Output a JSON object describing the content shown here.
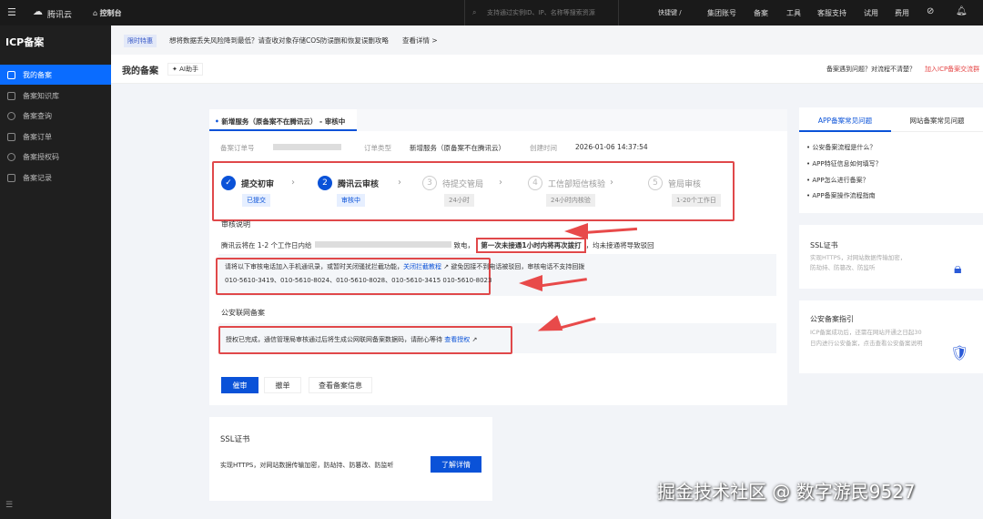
{
  "topbar": {
    "brand": "腾讯云",
    "console": "控制台",
    "search_placeholder": "支持通过实例ID、IP、名称等搜索资源",
    "shortcut": "快捷键 /",
    "nav": [
      "集团账号",
      "备案",
      "工具",
      "客服支持",
      "试用",
      "费用"
    ]
  },
  "sidebar": {
    "title": "ICP备案",
    "items": [
      {
        "label": "我的备案"
      },
      {
        "label": "备案知识库"
      },
      {
        "label": "备案查询"
      },
      {
        "label": "备案订单"
      },
      {
        "label": "备案授权码"
      },
      {
        "label": "备案记录"
      }
    ]
  },
  "notice": {
    "badge": "限时特惠",
    "text": "想将数据丢失风险降到最低？请查收对象存储COS防误删和恢复误删攻略",
    "link": "查看详情 >"
  },
  "header": {
    "title": "我的备案",
    "ai": "AI助手",
    "help": "备案遇到问题？对流程不清楚？",
    "help_link": "加入ICP备案交流群"
  },
  "order": {
    "tab": "新增服务（原备案不在腾讯云） - 审核中",
    "no_label": "备案订单号",
    "type_label": "订单类型",
    "type_value": "新增服务（原备案不在腾讯云）",
    "time_label": "创建时间",
    "time_value": "2026-01-06 14:37:54"
  },
  "steps": [
    {
      "num": "✓",
      "label": "提交初审",
      "tag": "已提交"
    },
    {
      "num": "2",
      "label": "腾讯云审核",
      "tag": "审核中"
    },
    {
      "num": "3",
      "label": "待提交管局",
      "tag": "24小时"
    },
    {
      "num": "4",
      "label": "工信部短信核验",
      "tag": "24小时内核验"
    },
    {
      "num": "5",
      "label": "管局审核",
      "tag": "1-20个工作日"
    }
  ],
  "review": {
    "title": "审核说明",
    "line_a": "腾讯云将在 1-2 个工作日内给",
    "line_b": "致电，",
    "highlight": "第一次未接通1小时内将再次拨打",
    "line_c": "，均未接通将导致驳回",
    "tip_a": "请将以下审核电话加入手机通讯录，或暂时关闭骚扰拦截功能，",
    "tip_link": "关闭拦截教程",
    "tip_b": "避免因接不到电话被驳回，审核电话不支持回拨",
    "phones": "010-5610-3419、010-5610-8024、010-5610-8028、010-5610-3415 010-5610-8023"
  },
  "police": {
    "title": "公安联网备案",
    "text": "授权已完成，通信管理局审核通过后将生成公网联网备案数据码，请耐心等待",
    "link": "查看授权"
  },
  "actions": {
    "urge": "催审",
    "withdraw": "撤单",
    "view": "查看备案信息"
  },
  "ssl_card": {
    "title": "SSL证书",
    "desc": "实现HTTPS，对网站数据传输加密，防劫持、防篡改、防监听",
    "button": "了解详情"
  },
  "faq": {
    "tabs": [
      "APP备案常见问题",
      "网站备案常见问题"
    ],
    "items": [
      "公安备案流程是什么？",
      "APP特征信息如何填写？",
      "APP怎么进行备案？",
      "APP备案操作流程指南"
    ]
  },
  "promo": [
    {
      "title": "SSL证书",
      "desc": "实现HTTPS，对网站数据传输加密，防劫持、防篡改、防监听"
    },
    {
      "title": "公安备案指引",
      "desc": "ICP备案成功后，还需在网站开通之日起30日内进行公安备案，点击查看公安备案说明"
    }
  ],
  "watermark": "掘金技术社区 @ 数字游民9527"
}
